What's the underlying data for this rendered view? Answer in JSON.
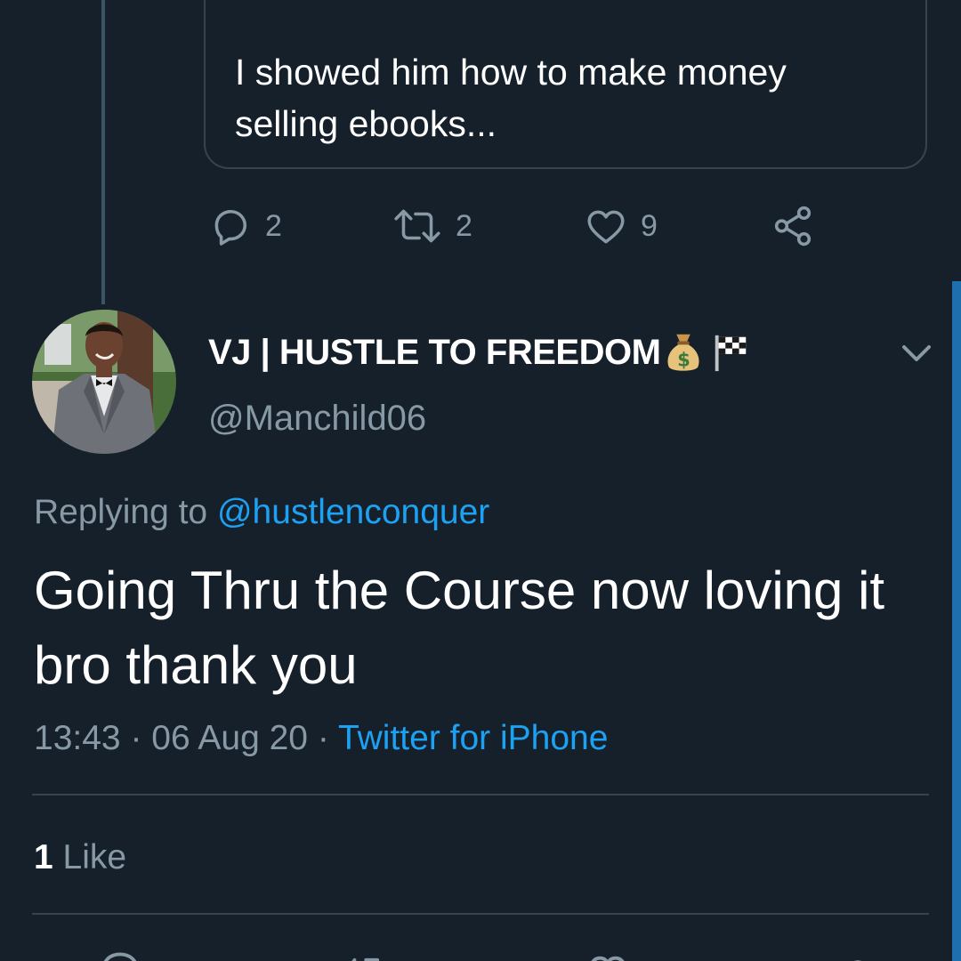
{
  "colors": {
    "background": "#15202b",
    "text_primary": "#ffffff",
    "text_secondary": "#8899a6",
    "accent": "#1da1f2",
    "border": "#38444d"
  },
  "quoted_tweet": {
    "text": "I showed him how to make money selling ebooks..."
  },
  "parent_actions": {
    "reply_count": "2",
    "retweet_count": "2",
    "like_count": "9",
    "icons": [
      "reply-icon",
      "retweet-icon",
      "like-icon",
      "share-icon"
    ]
  },
  "author": {
    "display_name": "VJ | HUSTLE TO FREEDOM",
    "name_emojis": [
      "money-bag-icon",
      "checkered-flag-icon"
    ],
    "handle": "@Manchild06"
  },
  "tweet": {
    "replying_label": "Replying to",
    "replying_to": "@hustlenconquer",
    "text": "Going Thru the Course now loving it bro thank you",
    "time": "13:43",
    "date": "06 Aug 20",
    "separator": "·",
    "source": "Twitter for iPhone"
  },
  "stats": {
    "likes_count": "1",
    "likes_label": "Like"
  }
}
